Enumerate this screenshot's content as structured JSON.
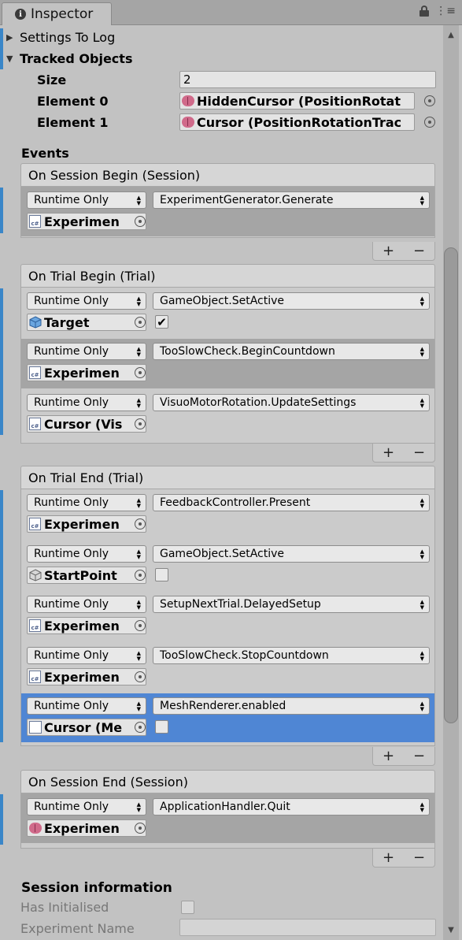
{
  "tab": {
    "title": "Inspector",
    "icon": "info-icon"
  },
  "tracking": {
    "settings_to_log": "Settings To Log",
    "tracked_objects": "Tracked Objects",
    "size_label": "Size",
    "size_value": "2",
    "elements": [
      {
        "label": "Element 0",
        "value": "HiddenCursor (PositionRotat"
      },
      {
        "label": "Element 1",
        "value": "Cursor (PositionRotationTrac"
      }
    ]
  },
  "events_label": "Events",
  "groups": [
    {
      "title": "On Session Begin (Session)",
      "entries": [
        {
          "mode": "Runtime Only",
          "function": "ExperimentGenerator.Generate",
          "object": "Experimen",
          "icon": "script-icon"
        }
      ]
    },
    {
      "title": "On Trial Begin (Trial)",
      "entries": [
        {
          "mode": "Runtime Only",
          "function": "GameObject.SetActive",
          "object": "Target",
          "icon": "cube-icon",
          "checkbox": "✔"
        },
        {
          "mode": "Runtime Only",
          "function": "TooSlowCheck.BeginCountdown",
          "object": "Experimen",
          "icon": "script-icon"
        },
        {
          "mode": "Runtime Only",
          "function": "VisuoMotorRotation.UpdateSettings",
          "object": "Cursor (Vis",
          "icon": "script-icon"
        }
      ]
    },
    {
      "title": "On Trial End (Trial)",
      "entries": [
        {
          "mode": "Runtime Only",
          "function": "FeedbackController.Present",
          "object": "Experimen",
          "icon": "script-icon"
        },
        {
          "mode": "Runtime Only",
          "function": "GameObject.SetActive",
          "object": "StartPoint",
          "icon": "gray-cube-icon",
          "checkbox": ""
        },
        {
          "mode": "Runtime Only",
          "function": "SetupNextTrial.DelayedSetup",
          "object": "Experimen",
          "icon": "script-icon"
        },
        {
          "mode": "Runtime Only",
          "function": "TooSlowCheck.StopCountdown",
          "object": "Experimen",
          "icon": "script-icon"
        },
        {
          "mode": "Runtime Only",
          "function": "MeshRenderer.enabled",
          "object": "Cursor (Me",
          "icon": "meshrenderer-icon",
          "checkbox": ""
        }
      ]
    },
    {
      "title": "On Session End (Session)",
      "entries": [
        {
          "mode": "Runtime Only",
          "function": "ApplicationHandler.Quit",
          "object": "Experimen",
          "icon": "brain-icon"
        }
      ]
    }
  ],
  "footer": {
    "plus": "+",
    "minus": "−"
  },
  "session_info": {
    "title": "Session information",
    "has_initialised": "Has Initialised",
    "experiment_name": "Experiment Name"
  },
  "colors": {
    "accent": "#3a86c8",
    "selected": "#4f86d4"
  }
}
